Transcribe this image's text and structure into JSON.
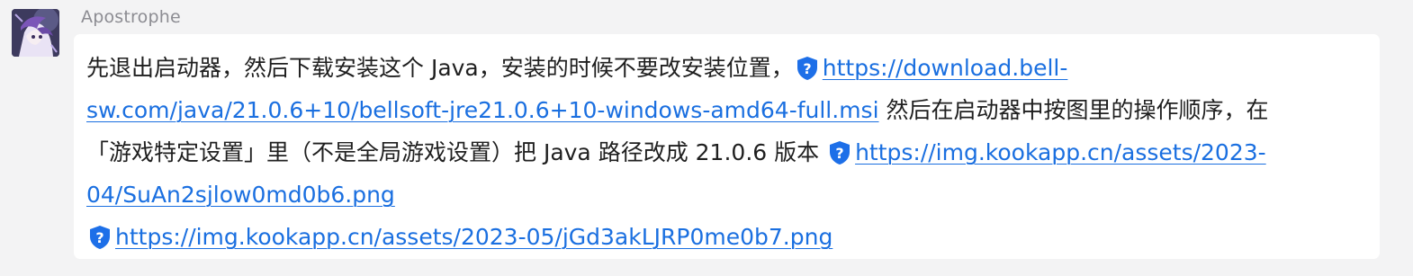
{
  "user": {
    "name": "Apostrophe",
    "avatar_icon": "avatar-icon"
  },
  "message": {
    "text_1": "先退出启动器，然后下载安装这个 Java，安装的时候不要改安装位置，",
    "link_1_part1": "https://download.bell-",
    "link_1_part2": "sw.com/java/21.0.6+10/bellsoft-jre21.0.6+10-windows-amd64-full.msi",
    "text_2": " 然后在启动器中按图里的操作顺序，在",
    "text_3": "「游戏特定设置」里（不是全局游戏设置）把 Java 路径改成 21.0.6 版本 ",
    "link_2_part1": "https://img.kookapp.cn/assets/2023-",
    "link_2_part2": "04/SuAn2sjlow0md0b6.png",
    "link_3": "https://img.kookapp.cn/assets/2023-05/jGd3akLJRP0me0b7.png",
    "link_icon": "shield-question-icon"
  },
  "colors": {
    "background": "#f3f3f4",
    "bubble": "#ffffff",
    "link": "#1a6fe0",
    "shield": "#1d6fe8",
    "username": "#8c8c92",
    "text": "#1f1f1f"
  }
}
